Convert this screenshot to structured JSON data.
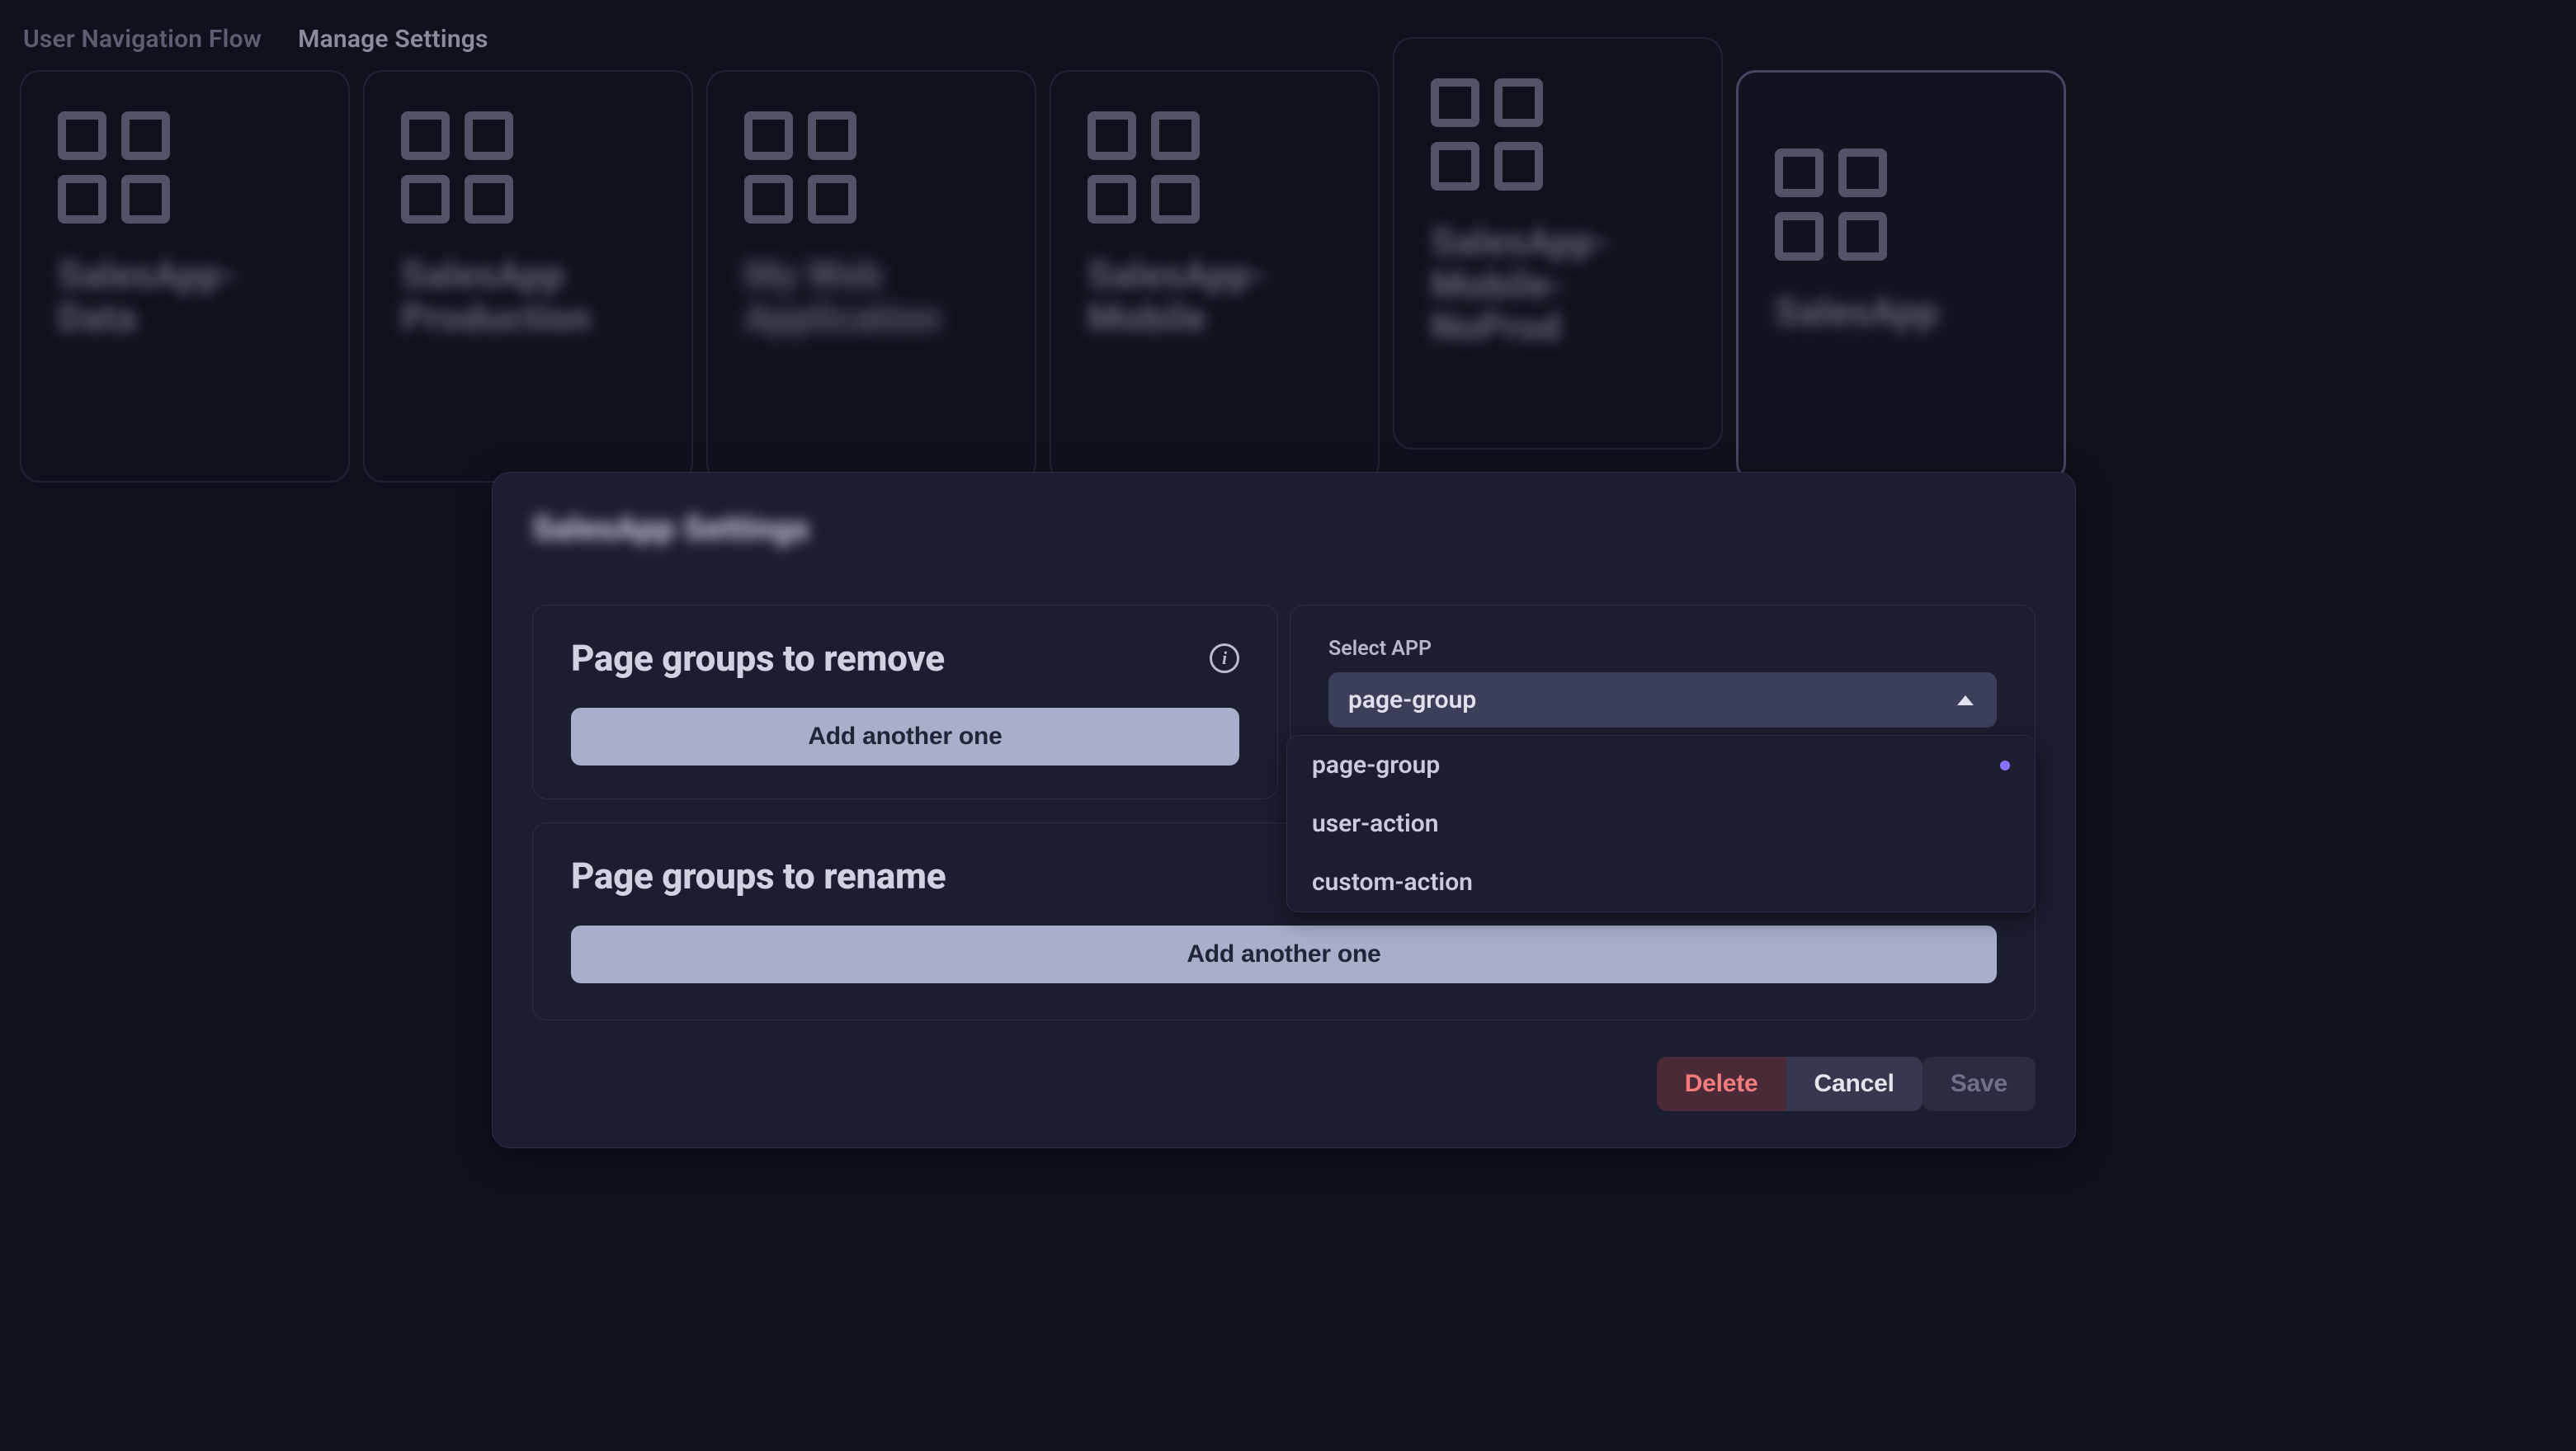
{
  "breadcrumb": {
    "items": [
      {
        "label": "User Navigation Flow"
      },
      {
        "label": "Manage Settings"
      }
    ]
  },
  "app_cards": [
    {
      "label": "SalesApp-Data"
    },
    {
      "label": "SalesApp Production"
    },
    {
      "label": "My Web Application"
    },
    {
      "label": "SalesApp-Mobile"
    },
    {
      "label": "SalesApp-Mobile-NoProd"
    },
    {
      "label": "SalesApp",
      "selected": true
    }
  ],
  "modal": {
    "title": "SalesApp Settings",
    "remove_panel": {
      "title": "Page groups to remove",
      "add_button": "Add another one"
    },
    "select_panel": {
      "label": "Select APP",
      "value": "page-group",
      "options": [
        {
          "label": "page-group",
          "selected": true
        },
        {
          "label": "user-action",
          "selected": false
        },
        {
          "label": "custom-action",
          "selected": false
        }
      ]
    },
    "rename_panel": {
      "title": "Page groups to rename",
      "add_button": "Add another one"
    },
    "actions": {
      "delete": "Delete",
      "cancel": "Cancel",
      "save": "Save"
    }
  }
}
